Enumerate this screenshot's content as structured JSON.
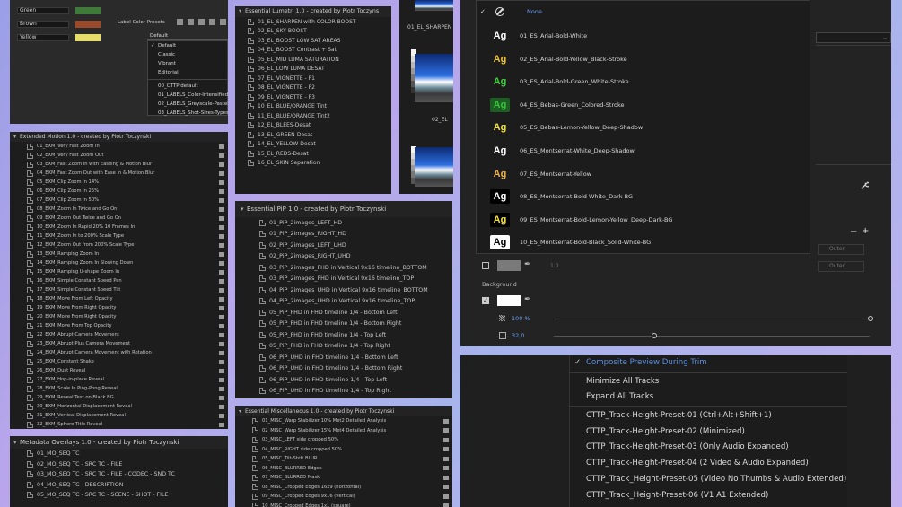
{
  "label_colors": {
    "labels": [
      {
        "name": "Green",
        "color": "#3f7a3b"
      },
      {
        "name": "Brown",
        "color": "#9a4a2a"
      },
      {
        "name": "Yellow",
        "color": "#e6dc6a"
      }
    ],
    "presets_label": "Label Color Presets",
    "selected": "Default",
    "menu": {
      "group1": [
        "Default",
        "Classic",
        "Vibrant",
        "Editorial"
      ],
      "group2": [
        "00_CTTP default",
        "01_LABELS_Color-Intensified",
        "02_LABELS_Greyscale-Pastel",
        "03_LABELS_Shot-Sizes-Types"
      ],
      "checked": "Default"
    }
  },
  "extended_motion": {
    "title": "Extended Motion 1.0 - created by Piotr Toczynski",
    "items": [
      "01_EXM_Very Fast Zoom In",
      "02_EXM_Very Fast Zoom Out",
      "03_EXM_Fast Zoom in with Easeing & Motion Blur",
      "04_EXM_Fast Zoom Out with Ease In & Motion Blur",
      "05_EXM_Clip Zoom in 14%",
      "06_EXM_Clip Zoom in 25%",
      "07_EXM_Clip Zoom in 50%",
      "08_EXM_Zoom In Twice and Go On",
      "09_EXM_Zoom Out Twice and Go On",
      "10_EXM_Zoom In Rapid 20% 10 Frames In",
      "11_EXM_Zoom In to 200% Scale Type",
      "12_EXM_Zoom Out from 200% Scale Type",
      "13_EXM_Ramping Zoom In",
      "14_EXM_Ramping Zoom In Slowing Down",
      "15_EXM_Ramping U-shape Zoom In",
      "16_EXM_Simple Constant Speed Pan",
      "17_EXM_Simple Constant Speed Tilt",
      "18_EXM_Move From Left Opacity",
      "19_EXM_Move From Right Opacity",
      "20_EXM_Move From Right Opacity",
      "21_EXM_Move From Top Opacity",
      "22_EXM_Abrupt Camera Movement",
      "23_EXM_Abrupt Plus Camera Movement",
      "24_EXM_Abrupt Camera Movement with Rotation",
      "25_EXM_Constant Shake",
      "26_EXM_Dust Reveal",
      "27_EXM_Hop-in-place Reveal",
      "28_EXM_Scale In Ping-Pong Reveal",
      "29_EXM_Reveal Text on Black BG",
      "30_EXM_Horizontal Displacement Reveal",
      "31_EXM_Vertical Displacement Reveal",
      "32_EXM_Sphere Title Reveal"
    ]
  },
  "metadata_overlays": {
    "title": "Metadata Overlays 1.0 - created by Piotr Toczynski",
    "items": [
      "01_MO_SEQ TC",
      "02_MO_SEQ TC - SRC TC - FILE",
      "03_MO_SEQ TC - SRC TC - FILE - CODEC - SND TC",
      "04_MO_SEQ TC - DESCRIPTION",
      "05_MO_SEQ TC - SRC TC - SCENE - SHOT - FILE"
    ]
  },
  "lumetri": {
    "title": "Essential Lumetri 1.0 - created by Piotr Toczyns",
    "items": [
      "01_EL_SHARPEN with COLOR BOOST",
      "02_EL_SKY BOOST",
      "03_EL_BOOST LOW SAT AREAS",
      "04_EL_BOOST Contrast + Sat",
      "05_EL_MID LUMA SATURATION",
      "06_EL_LOW LUMA DESAT",
      "07_EL_VIGNETTE - P1",
      "08_EL_VIGNETTE - P2",
      "09_EL_VIGNETTE - P3",
      "10_EL_BLUE/ORANGE Tint",
      "11_EL_BLUE/ORANGE Tint2",
      "12_EL_BLEES-Desat",
      "13_EL_GREEN-Desat",
      "14_EL_YELLOW-Desat",
      "15_EL_REDS-Desat",
      "16_EL_SKIN Separation"
    ]
  },
  "thumbs": {
    "label1": "01_EL_SHARPEN",
    "label2": "02_EL"
  },
  "pip": {
    "title": "Essential PiP 1.0 - created by Piotr Toczynski",
    "items": [
      "01_PiP_2images_LEFT_HD",
      "01_PiP_2images_RIGHT_HD",
      "02_PiP_2images_LEFT_UHD",
      "02_PiP_2images_RIGHT_UHD",
      "03_PiP_2images_FHD in Vertical 9x16 timeline_BOTTOM",
      "03_PiP_2images_FHD in Vertical 9x16 timeline_TOP",
      "04_PiP_2images_UHD in Vertical 9x16 timeline_BOTTOM",
      "04_PiP_2images_UHD in Vertical 9x16 timeline_TOP",
      "05_PiP_FHD in FHD timeline 1/4 - Bottom Left",
      "05_PiP_FHD in FHD timeline 1/4 - Bottom Right",
      "05_PiP_FHD in FHD timeline 1/4 - Top Left",
      "05_PiP_FHD in FHD timeline 1/4 - Top Right",
      "06_PiP_UHD in FHD timeline 1/4 - Bottom Left",
      "06_PiP_UHD in FHD timeline 1/4 - Bottom Right",
      "06_PiP_UHD in FHD timeline 1/4 - Top Left",
      "06_PiP_UHD in FHD timeline 1/4 - Top Right"
    ]
  },
  "misc": {
    "title": "Essential Miscellaneous 1.0 - created by Piotr Toczynski",
    "items": [
      "01_MISC_Warp Stabilizer 10% Met2 Detailed Analysis",
      "02_MISC_Warp Stabilizer 15% Met4 Detailed Analysis",
      "03_MISC_LEFT side cropped 50%",
      "04_MISC_RIGHT side cropped 50%",
      "05_MISC_Tilt-Shift BLUR",
      "06_MISC_BLURRED Edges",
      "07_MISC_BLURRED Mask",
      "08_MISC_Cropped Edges 16x9 (horizontal)",
      "09_MISC_Cropped Edges 9x16 (vertical)",
      "10_MISC_Cropped Edges 1x1 (square)"
    ]
  },
  "captions": {
    "none_label": "None",
    "styles": [
      {
        "name": "01_ES_Arial-Bold-White",
        "fg": "#ffffff",
        "bg": "transparent"
      },
      {
        "name": "02_ES_Arial-Bold-Yellow_Black-Stroke",
        "fg": "#f0c23a",
        "bg": "transparent"
      },
      {
        "name": "03_ES_Arial-Bold-Green_White-Stroke",
        "fg": "#3fcf3a",
        "bg": "transparent"
      },
      {
        "name": "04_ES_Bebas-Green_Colored-Stroke",
        "fg": "#38c33b",
        "bg": "#1d5e22"
      },
      {
        "name": "05_ES_Bebas-Lemon-Yellow_Deep-Shadow",
        "fg": "#f0e23c",
        "bg": "transparent"
      },
      {
        "name": "06_ES_Montserrat-White_Deep-Shadow",
        "fg": "#ffffff",
        "bg": "transparent"
      },
      {
        "name": "07_ES_Montserrat-Yellow",
        "fg": "#f0b048",
        "bg": "transparent"
      },
      {
        "name": "08_ES_Montserrat-Bold-White_Dark-BG",
        "fg": "#ffffff",
        "bg": "#000000"
      },
      {
        "name": "09_ES_Montserrat-Bold-Lemon-Yellow_Deep-Dark-BG",
        "fg": "#f2e23a",
        "bg": "#000000"
      },
      {
        "name": "10_ES_Montserrat-Bold-Black_Solid-White-BG",
        "fg": "#000000",
        "bg": "#ffffff"
      }
    ],
    "outer1": "Outer",
    "outer2": "Outer",
    "stroke_value": "1.0",
    "background_label": "Background",
    "opacity_value": "100 %",
    "size_value": "32,0"
  },
  "timeline_menu": {
    "checked_item": "Composite Preview During Trim",
    "items": [
      "Minimize All Tracks",
      "Expand All Tracks",
      "CTTP_Track-Height-Preset-01 (Ctrl+Alt+Shift+1)",
      "CTTP_Track-Height-Preset-02 (Minimized)",
      "CTTP_Track-Height-Preset-03 (Only Audio Expanded)",
      "CTTP_Track-Height-Preset-04 (2 Video & Audio Expanded)",
      "CTTP_Track_Height-Preset-05 (Video No Thumbs & Audio Extended)",
      "CTTP_Track_Height-Preset-06 (V1 A1 Extended)"
    ]
  }
}
